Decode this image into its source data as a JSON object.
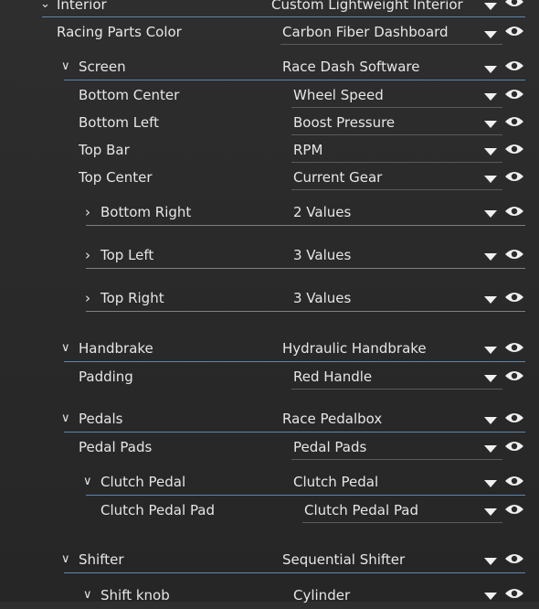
{
  "rows": [
    {
      "label": "Interior",
      "value": "Custom Lightweight Interior",
      "expand": "open"
    },
    {
      "label": "Racing Parts Color",
      "value": "Carbon Fiber Dashboard",
      "expand": ""
    },
    {
      "label": "Screen",
      "value": "Race Dash Software",
      "expand": "open"
    },
    {
      "label": "Bottom Center",
      "value": "Wheel Speed",
      "expand": ""
    },
    {
      "label": "Bottom Left",
      "value": "Boost Pressure",
      "expand": ""
    },
    {
      "label": "Top Bar",
      "value": "RPM",
      "expand": ""
    },
    {
      "label": "Top Center",
      "value": "Current Gear",
      "expand": ""
    },
    {
      "label": "Bottom Right",
      "value": "2 Values",
      "expand": "closed"
    },
    {
      "label": "Top Left",
      "value": "3 Values",
      "expand": "closed"
    },
    {
      "label": "Top Right",
      "value": "3 Values",
      "expand": "closed"
    },
    {
      "label": "Handbrake",
      "value": "Hydraulic Handbrake",
      "expand": "open"
    },
    {
      "label": "Padding",
      "value": "Red Handle",
      "expand": ""
    },
    {
      "label": "Pedals",
      "value": "Race Pedalbox",
      "expand": "open"
    },
    {
      "label": "Pedal Pads",
      "value": "Pedal Pads",
      "expand": ""
    },
    {
      "label": "Clutch Pedal",
      "value": "Clutch Pedal",
      "expand": "open"
    },
    {
      "label": "Clutch Pedal Pad",
      "value": "Clutch Pedal Pad",
      "expand": ""
    },
    {
      "label": "Shifter",
      "value": "Sequential Shifter",
      "expand": "open"
    },
    {
      "label": "Shift knob",
      "value": "Cylinder",
      "expand": "open"
    }
  ],
  "icons": {
    "expand_open": "chevron-down-icon",
    "expand_closed": "chevron-right-icon",
    "dropdown": "caret-down-icon",
    "visibility": "eye-icon"
  },
  "colors": {
    "background": "#2a2a2a",
    "text": "#e6e6e6",
    "divider_blue": "#5c86ad"
  }
}
